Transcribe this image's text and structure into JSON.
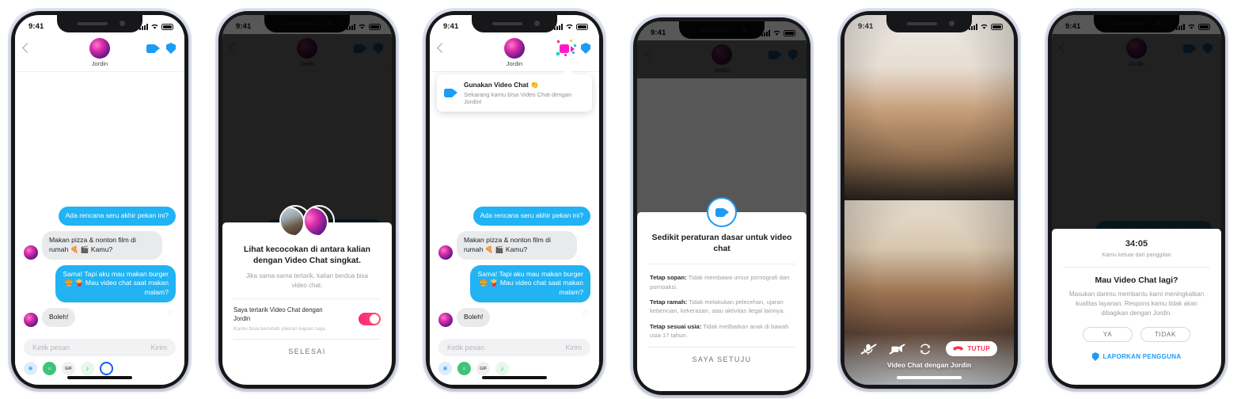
{
  "status_bar": {
    "time": "9:41",
    "signal_icon": "cellular-bars-icon",
    "wifi_icon": "wifi-icon",
    "battery_icon": "battery-icon"
  },
  "chat_header": {
    "contact_name": "Jordin",
    "back_icon": "back-chevron-icon",
    "video_icon": "video-camera-icon",
    "shield_icon": "shield-icon",
    "avatar": "contact-avatar"
  },
  "conversation": {
    "messages": [
      {
        "side": "out",
        "text": "Ada rencana seru akhir pekan ini?"
      },
      {
        "side": "in",
        "text": "Makan pizza & nonton film di rumah 🍕 🎬 Kamu?"
      },
      {
        "side": "out",
        "text": "Sama! Tapi aku mau makan burger 🍔 🍟 Mau video chat saat makan malam?"
      },
      {
        "side": "in",
        "text": "Boleh!"
      }
    ],
    "composer_placeholder": "Ketik pesan",
    "send_label": "Kirim",
    "tray_icons": [
      "gif-pill-icon",
      "sticker-icon",
      "gif-icon",
      "music-note-icon",
      "spotify-icon"
    ],
    "like_icon": "heart-outline-icon"
  },
  "screen2_optin_sheet": {
    "title": "Lihat kecocokan di antara kalian dengan Video Chat singkat.",
    "subtitle": "Jika sama-sama tertarik, kalian berdua bisa video chat.",
    "toggle_label": "Saya tertarik Video Chat dengan Jordin",
    "toggle_hint": "Kamu bisa berubah pikiran kapan saja",
    "toggle_state": "on",
    "toggle_color": "#fd3a63",
    "action_label": "SELESAI",
    "avatars": [
      "avatar-self",
      "avatar-jordin"
    ]
  },
  "screen3_tooltip": {
    "title": "Gunakan Video Chat 👏",
    "subtitle": "Sekarang kamu bisa Video Chat dengan Jordin!",
    "icon": "video-camera-icon",
    "header_icon": "animated-video-chat-icon"
  },
  "screen4_rules_sheet": {
    "badge_icon": "video-camera-icon",
    "title": "Sedikit peraturan dasar untuk video chat",
    "rules": [
      {
        "bold": "Tetap sopan:",
        "text": " Tidak membawa unsur pornografi dan pornoaksi."
      },
      {
        "bold": "Tetap ramah:",
        "text": "  Tidak melakukan pelecehan, ujaran kebencian, kekerasan, atau aktivitas ilegal lainnya."
      },
      {
        "bold": "Tetap sesuai usia:",
        "text": "  Tidak melibatkan anak di bawah usia 17 tahun."
      }
    ],
    "action_label": "SAYA SETUJU"
  },
  "screen5_call": {
    "caption": "Video Chat dengan Jordin",
    "controls": [
      "mic-muted-icon",
      "video-muted-icon",
      "flip-camera-icon"
    ],
    "hangup_label": "TUTUP",
    "hangup_icon": "phone-hangup-icon",
    "hangup_color": "#ff2e4e"
  },
  "screen6_feedback_sheet": {
    "duration": "34:05",
    "duration_sub": "Kamu keluar dari panggilan",
    "question": "Mau Video Chat lagi?",
    "description": "Masukan darimu membantu kami meningkatkan kualitas layanan. Respons kamu tidak akan dibagikan dengan Jordin.",
    "yes_label": "YA",
    "no_label": "TIDAK",
    "report_label": "LAPORKAN PENGGUNA",
    "report_icon": "shield-icon",
    "report_color": "#1d9bf6"
  }
}
